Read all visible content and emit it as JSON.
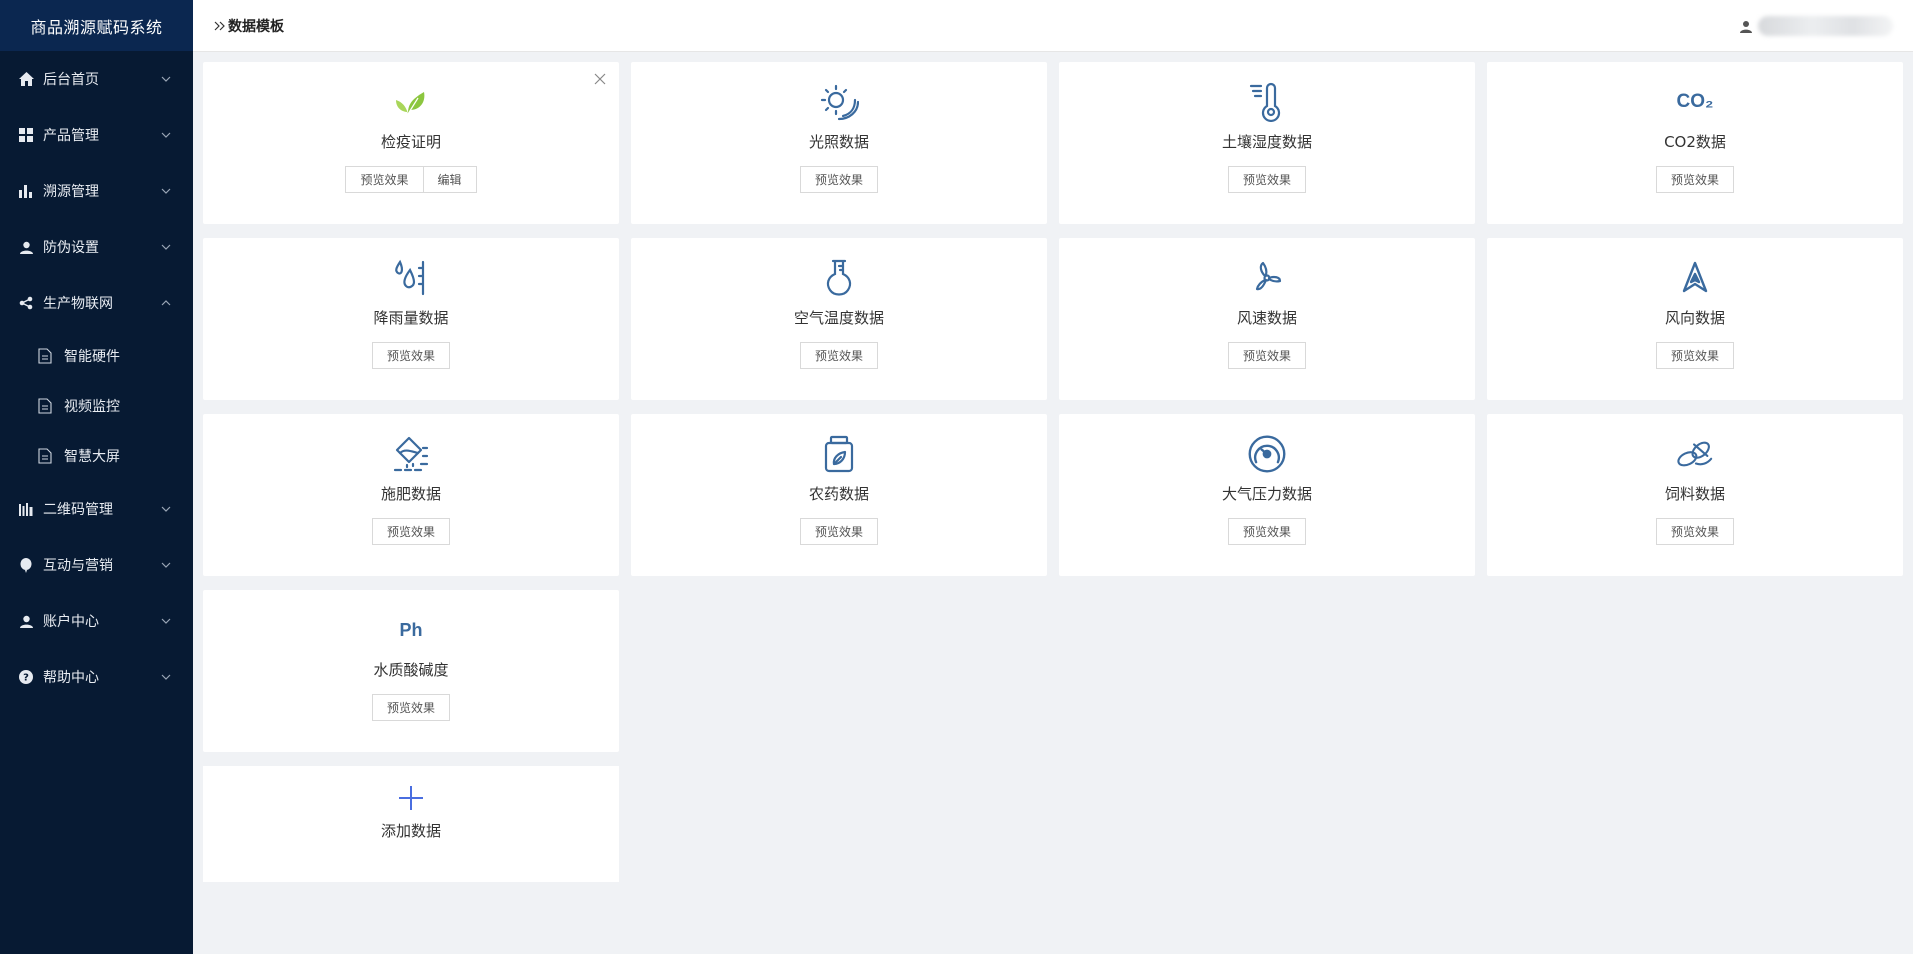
{
  "app": {
    "title": "商品溯源赋码系统"
  },
  "sidebar": {
    "items": [
      {
        "label": "后台首页",
        "icon": "home-icon"
      },
      {
        "label": "产品管理",
        "icon": "grid-icon"
      },
      {
        "label": "溯源管理",
        "icon": "bar-chart-icon"
      },
      {
        "label": "防伪设置",
        "icon": "user-icon"
      },
      {
        "label": "生产物联网",
        "icon": "share-icon",
        "expanded": true,
        "children": [
          {
            "label": "智能硬件"
          },
          {
            "label": "视频监控"
          },
          {
            "label": "智慧大屏"
          }
        ]
      },
      {
        "label": "二维码管理",
        "icon": "qrcode-icon"
      },
      {
        "label": "互动与营销",
        "icon": "balloon-icon"
      },
      {
        "label": "账户中心",
        "icon": "user-icon"
      },
      {
        "label": "帮助中心",
        "icon": "help-icon"
      }
    ]
  },
  "header": {
    "breadcrumb": "数据模板"
  },
  "cards": [
    {
      "title": "检疫证明",
      "icon": "leaf-icon",
      "preview": "预览效果",
      "edit": "编辑"
    },
    {
      "title": "光照数据",
      "icon": "sun-icon",
      "preview": "预览效果"
    },
    {
      "title": "土壤湿度数据",
      "icon": "thermometer-icon",
      "preview": "预览效果"
    },
    {
      "title": "CO2数据",
      "icon": "co2-icon",
      "icon_text": "CO₂",
      "preview": "预览效果"
    },
    {
      "title": "降雨量数据",
      "icon": "rain-drop-icon",
      "preview": "预览效果"
    },
    {
      "title": "空气温度数据",
      "icon": "flask-icon",
      "preview": "预览效果"
    },
    {
      "title": "风速数据",
      "icon": "fan-icon",
      "preview": "预览效果"
    },
    {
      "title": "风向数据",
      "icon": "direction-arrow-icon",
      "preview": "预览效果"
    },
    {
      "title": "施肥数据",
      "icon": "fertilizer-icon",
      "preview": "预览效果"
    },
    {
      "title": "农药数据",
      "icon": "pesticide-jar-icon",
      "preview": "预览效果"
    },
    {
      "title": "大气压力数据",
      "icon": "pressure-gauge-icon",
      "preview": "预览效果"
    },
    {
      "title": "饲料数据",
      "icon": "feed-icon",
      "preview": "预览效果"
    },
    {
      "title": "水质酸碱度",
      "icon": "ph-icon",
      "icon_text": "Ph",
      "preview": "预览效果"
    }
  ],
  "add": {
    "label": "添加数据"
  },
  "colors": {
    "sidebar": "#071a33",
    "brand_bar": "#0b2750",
    "icon": "#3a6a9e",
    "leaf": "#8cc63f",
    "add": "#4a6ee0"
  }
}
